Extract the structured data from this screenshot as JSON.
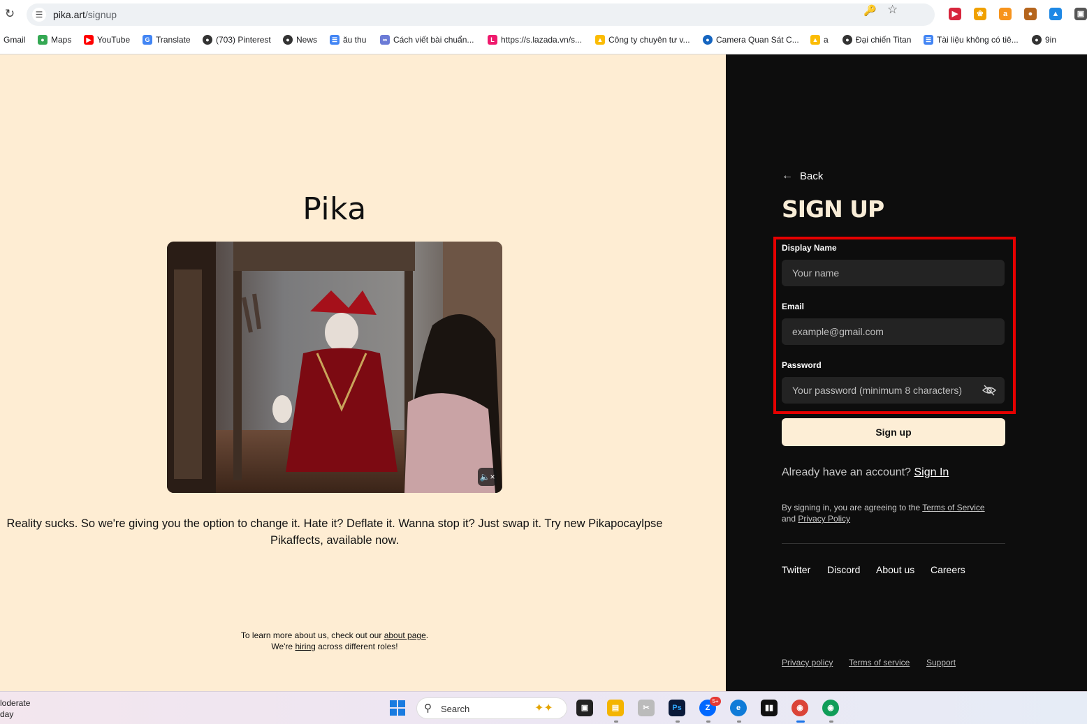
{
  "browser": {
    "url_host": "pika.art",
    "url_path": "/signup",
    "bookmarks": [
      {
        "label": "Gmail",
        "icon": "gmail-icon"
      },
      {
        "label": "Maps",
        "icon": "maps-icon"
      },
      {
        "label": "YouTube",
        "icon": "youtube-icon"
      },
      {
        "label": "Translate",
        "icon": "translate-icon"
      },
      {
        "label": "(703) Pinterest",
        "icon": "globe-icon"
      },
      {
        "label": "News",
        "icon": "globe-icon"
      },
      {
        "label": "ău thu",
        "icon": "doc-icon"
      },
      {
        "label": "Cách viết bài chuẩn...",
        "icon": "site-icon"
      },
      {
        "label": "https://s.lazada.vn/s...",
        "icon": "lazada-icon"
      },
      {
        "label": "Công ty chuyên tư v...",
        "icon": "drive-icon"
      },
      {
        "label": "Camera Quan Sát C...",
        "icon": "site-icon"
      },
      {
        "label": "a",
        "icon": "drive-icon"
      },
      {
        "label": "Đại chiến Titan",
        "icon": "globe-icon"
      },
      {
        "label": "Tài liệu không có tiê...",
        "icon": "doc-icon"
      },
      {
        "label": "9in",
        "icon": "globe-icon"
      }
    ]
  },
  "left": {
    "logo": "Pika",
    "tagline": "Reality sucks. So we're giving you the option to change it. Hate it? Deflate it. Wanna stop it? Just swap it. Try new Pikapocaylpse Pikaffects, available now.",
    "learn_prefix": "To learn more about us, check out our ",
    "learn_link": "about page",
    "learn_suffix": ".",
    "hiring_prefix": "We're ",
    "hiring_link": "hiring",
    "hiring_suffix": " across different roles!"
  },
  "signup": {
    "back": "Back",
    "title": "SIGN UP",
    "display_name_label": "Display Name",
    "display_name_placeholder": "Your name",
    "email_label": "Email",
    "email_placeholder": "example@gmail.com",
    "password_label": "Password",
    "password_placeholder": "Your password (minimum 8 characters)",
    "submit": "Sign up",
    "have_account": "Already have an account? ",
    "sign_in": "Sign In",
    "agree_prefix": "By signing in, you are agreeing to the ",
    "terms": "Terms of Service",
    "agree_and": "and ",
    "privacy": "Privacy Policy",
    "highlight_color": "#e50000"
  },
  "footer": {
    "links": [
      "Twitter",
      "Discord",
      "About us",
      "Careers"
    ],
    "bottom_links": [
      "Privacy policy",
      "Terms of service",
      "Support"
    ]
  },
  "taskbar": {
    "weather_line1": "loderate",
    "weather_line2": "day",
    "search_placeholder": "Search",
    "zalo_badge": "5+"
  }
}
